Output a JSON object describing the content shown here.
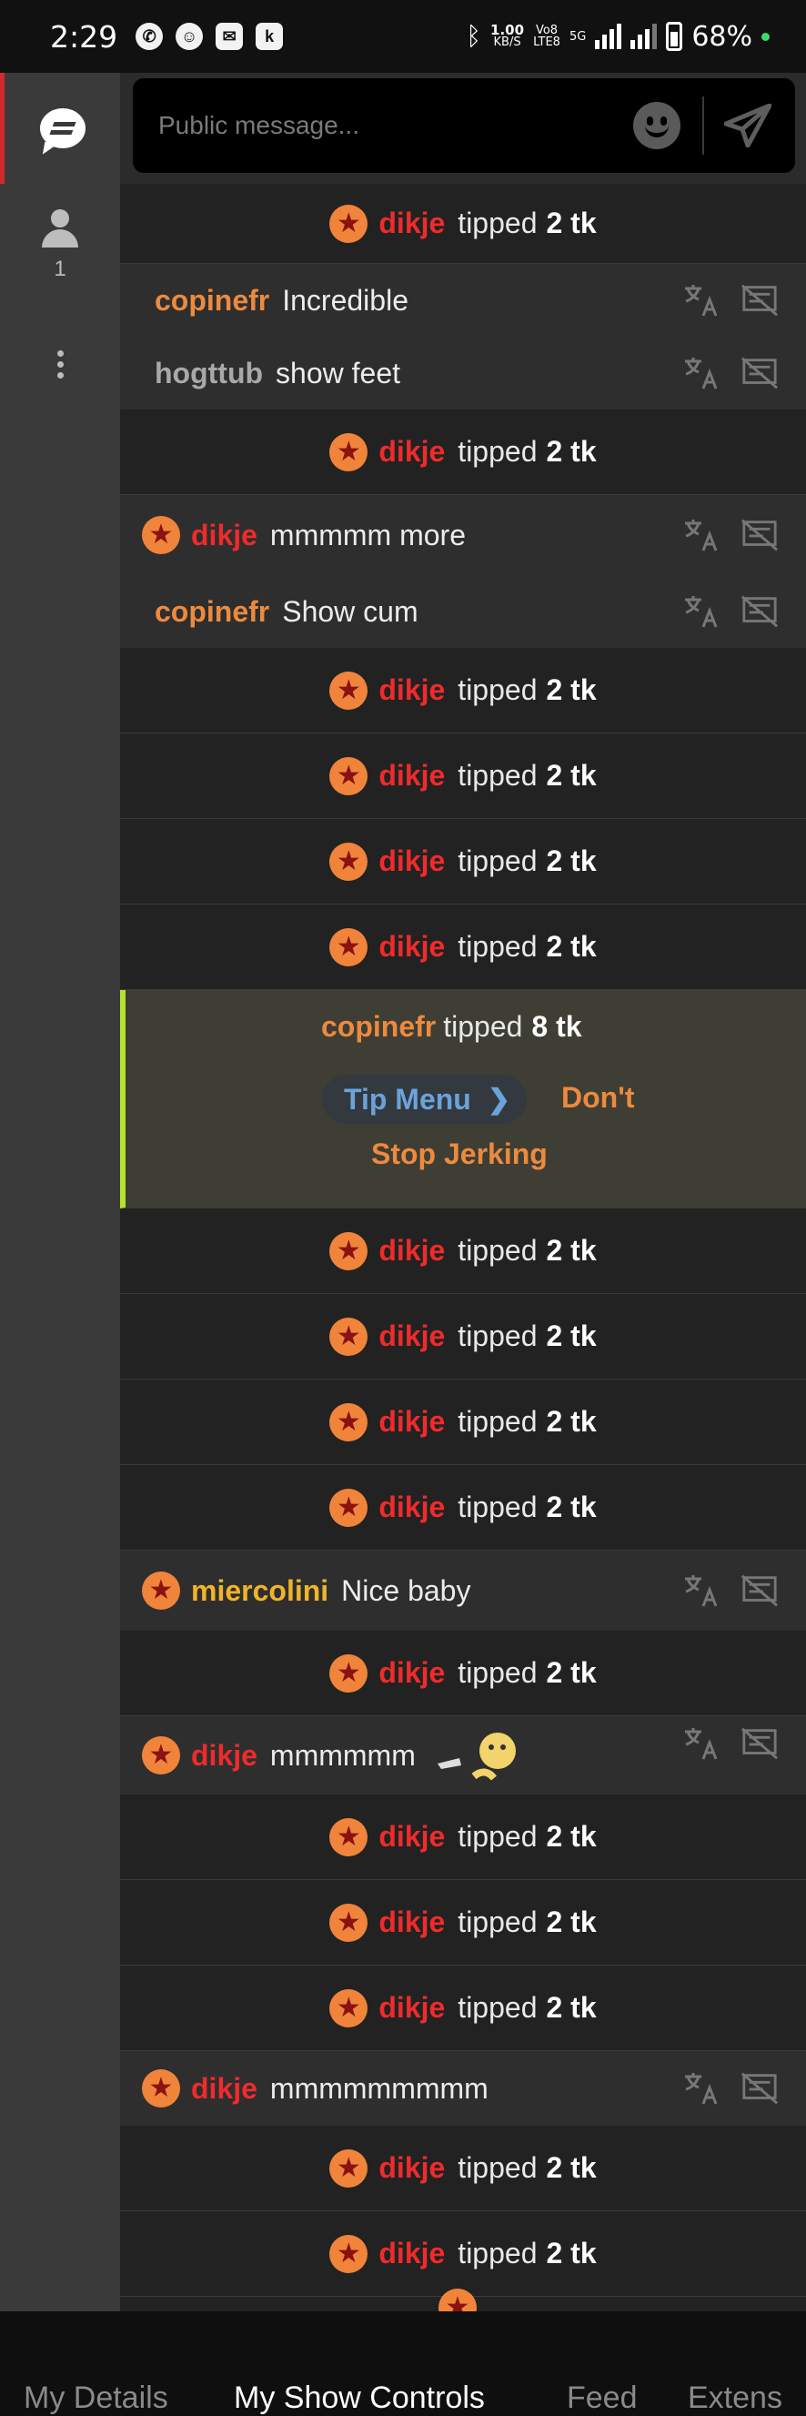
{
  "status_bar": {
    "time": "2:29",
    "speed_value": "1.00",
    "speed_unit": "KB/S",
    "volte": "Vo8",
    "lte": "LTE8",
    "network": "5G",
    "battery": "68%"
  },
  "rail": {
    "viewer_count": "1"
  },
  "composer": {
    "placeholder": "Public message..."
  },
  "messages": [
    {
      "user": "dikje",
      "tipped": "tipped",
      "amount": "2 tk"
    },
    {
      "user": "copinefr",
      "text": "Incredible"
    },
    {
      "user": "hogttub",
      "text": "show feet"
    },
    {
      "user": "dikje",
      "tipped": "tipped",
      "amount": "2 tk"
    },
    {
      "user": "dikje",
      "text": "mmmmm more"
    },
    {
      "user": "copinefr",
      "text": "Show cum"
    },
    {
      "user": "dikje",
      "tipped": "tipped",
      "amount": "2 tk"
    },
    {
      "user": "dikje",
      "tipped": "tipped",
      "amount": "2 tk"
    },
    {
      "user": "dikje",
      "tipped": "tipped",
      "amount": "2 tk"
    },
    {
      "user": "dikje",
      "tipped": "tipped",
      "amount": "2 tk"
    },
    {
      "user": "copinefr",
      "tipped": "tipped",
      "amount": "8 tk",
      "tip_menu": "Tip Menu",
      "line_a": "Don't",
      "line_b": "Stop Jerking"
    },
    {
      "user": "dikje",
      "tipped": "tipped",
      "amount": "2 tk"
    },
    {
      "user": "dikje",
      "tipped": "tipped",
      "amount": "2 tk"
    },
    {
      "user": "dikje",
      "tipped": "tipped",
      "amount": "2 tk"
    },
    {
      "user": "dikje",
      "tipped": "tipped",
      "amount": "2 tk"
    },
    {
      "user": "miercolini",
      "text": "Nice baby"
    },
    {
      "user": "dikje",
      "tipped": "tipped",
      "amount": "2 tk"
    },
    {
      "user": "dikje",
      "text": "mmmmmm"
    },
    {
      "user": "dikje",
      "tipped": "tipped",
      "amount": "2 tk"
    },
    {
      "user": "dikje",
      "tipped": "tipped",
      "amount": "2 tk"
    },
    {
      "user": "dikje",
      "tipped": "tipped",
      "amount": "2 tk"
    },
    {
      "user": "dikje",
      "text": "mmmmmmmmm"
    },
    {
      "user": "dikje",
      "tipped": "tipped",
      "amount": "2 tk"
    },
    {
      "user": "dikje",
      "tipped": "tipped",
      "amount": "2 tk"
    }
  ],
  "tabs": [
    "My Details",
    "My Show Controls",
    "Feed",
    "Extens"
  ],
  "colors": {
    "username_red": "#ef2b2b",
    "username_orange": "#ec8a3e",
    "username_gray": "#a8a8a8",
    "username_yellow": "#f0b429",
    "tip_menu_blue": "#6aa3dc",
    "highlight_border": "#b5e330",
    "star_badge": "#f0843a"
  },
  "icons": [
    "chat-icon",
    "user-icon",
    "more-icon",
    "emoji-icon",
    "send-icon",
    "translate-icon",
    "hide-message-icon",
    "star-badge-icon"
  ]
}
